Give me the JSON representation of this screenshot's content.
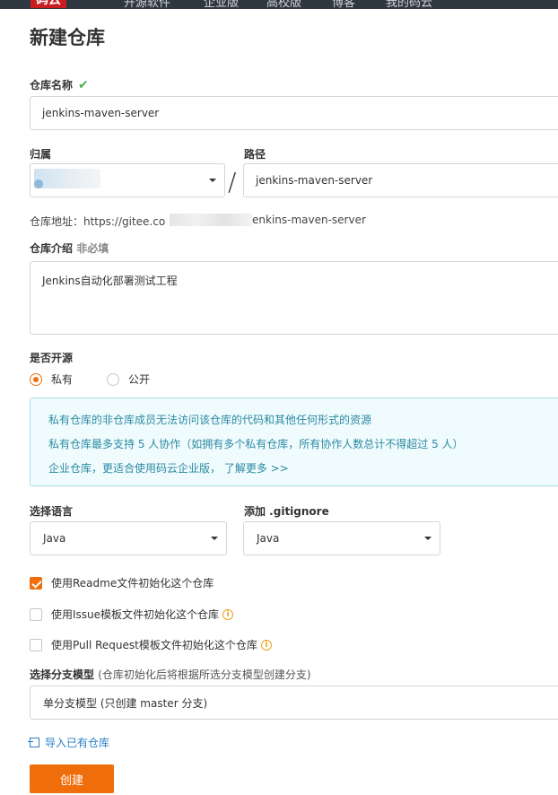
{
  "topbar": {
    "logo": "码云",
    "nav": [
      "开源软件",
      "企业版",
      "高校版",
      "博客",
      "我的码云"
    ]
  },
  "page_title": "新建仓库",
  "repo_name": {
    "label": "仓库名称",
    "value": "jenkins-maven-server"
  },
  "owner": {
    "label": "归属"
  },
  "path": {
    "label": "路径",
    "value": "jenkins-maven-server",
    "separator": "/"
  },
  "address": {
    "prefix": "仓库地址：https://gitee.co",
    "suffix": "enkins-maven-server"
  },
  "intro": {
    "label": "仓库介绍",
    "optional": "非必填",
    "value": "Jenkins自动化部署测试工程"
  },
  "open_source": {
    "label": "是否开源",
    "options": [
      {
        "label": "私有",
        "selected": true
      },
      {
        "label": "公开",
        "selected": false
      }
    ]
  },
  "notice": {
    "lines": [
      "私有仓库的非仓库成员无法访问该仓库的代码和其他任何形式的资源",
      "私有仓库最多支持 5 人协作（如拥有多个私有仓库，所有协作人数总计不得超过 5 人）",
      "企业仓库，更适合使用码云企业版， 了解更多 >>"
    ]
  },
  "language": {
    "label": "选择语言",
    "value": "Java"
  },
  "gitignore": {
    "label": "添加 .gitignore",
    "value": "Java"
  },
  "checkboxes": [
    {
      "label": "使用Readme文件初始化这个仓库",
      "checked": true,
      "info": false
    },
    {
      "label": "使用Issue模板文件初始化这个仓库",
      "checked": false,
      "info": true
    },
    {
      "label": "使用Pull Request模板文件初始化这个仓库",
      "checked": false,
      "info": true
    }
  ],
  "branch_model": {
    "label": "选择分支模型",
    "hint": "(仓库初始化后将根据所选分支模型创建分支)",
    "value": "单分支模型 (只创建 master 分支)"
  },
  "import_link": "导入已有仓库",
  "create_button": "创建",
  "colors": {
    "accent": "#f06d0c",
    "notice_text": "#2a8aa2",
    "link": "#2a7fc9"
  }
}
